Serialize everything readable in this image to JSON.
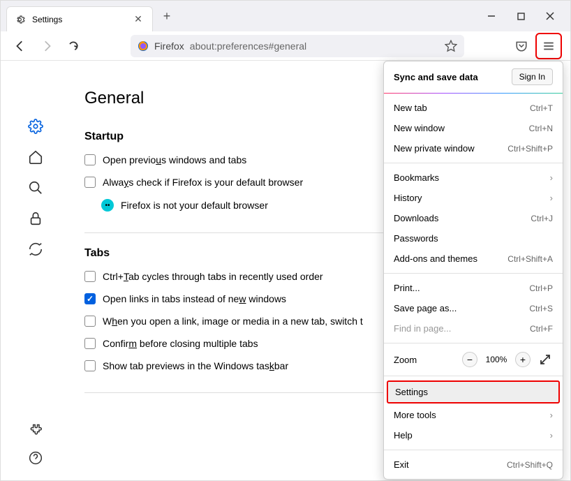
{
  "tab": {
    "title": "Settings"
  },
  "urlbar": {
    "identity": "Firefox",
    "url": "about:preferences#general"
  },
  "page": {
    "title": "General",
    "startup_heading": "Startup",
    "tabs_heading": "Tabs",
    "opt_open_previous": "Open previous windows and tabs",
    "opt_always_check": "Always check if Firefox is your default browser",
    "default_browser_msg": "Firefox is not your default browser",
    "opt_ctrl_tab": "Ctrl+Tab cycles through tabs in recently used order",
    "opt_open_links": "Open links in tabs instead of new windows",
    "opt_switch_to": "When you open a link, image or media in a new tab, switch t",
    "opt_confirm_close": "Confirm before closing multiple tabs",
    "opt_taskbar_preview": "Show tab previews in the Windows taskbar"
  },
  "menu": {
    "sync_title": "Sync and save data",
    "signin": "Sign In",
    "new_tab": "New tab",
    "new_tab_sc": "Ctrl+T",
    "new_window": "New window",
    "new_window_sc": "Ctrl+N",
    "new_private": "New private window",
    "new_private_sc": "Ctrl+Shift+P",
    "bookmarks": "Bookmarks",
    "history": "History",
    "downloads": "Downloads",
    "downloads_sc": "Ctrl+J",
    "passwords": "Passwords",
    "addons": "Add-ons and themes",
    "addons_sc": "Ctrl+Shift+A",
    "print": "Print...",
    "print_sc": "Ctrl+P",
    "save_as": "Save page as...",
    "save_as_sc": "Ctrl+S",
    "find": "Find in page...",
    "find_sc": "Ctrl+F",
    "zoom": "Zoom",
    "zoom_value": "100%",
    "settings": "Settings",
    "more_tools": "More tools",
    "help": "Help",
    "exit": "Exit",
    "exit_sc": "Ctrl+Shift+Q"
  }
}
